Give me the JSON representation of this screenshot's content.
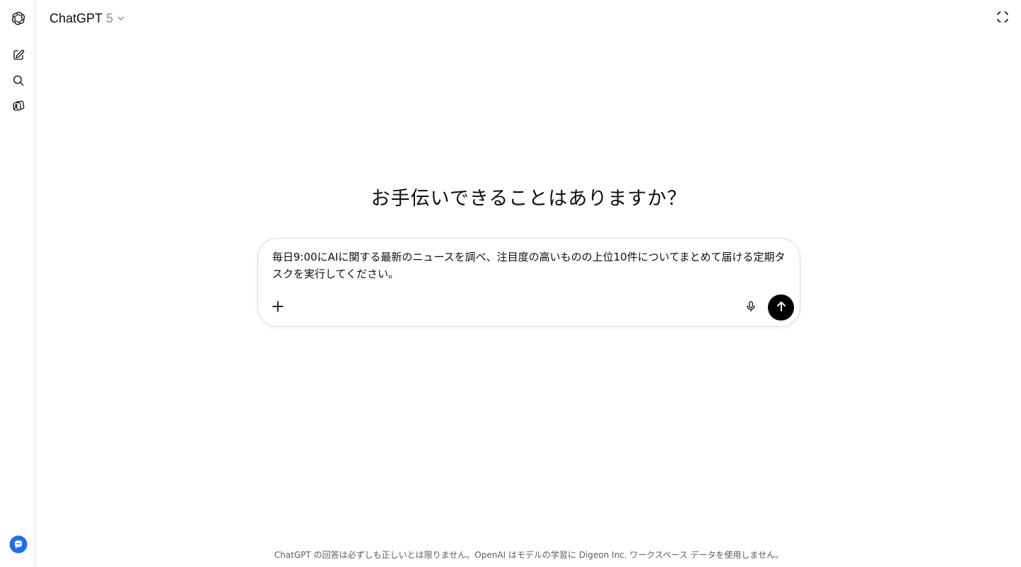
{
  "header": {
    "title": "ChatGPT",
    "version": "5"
  },
  "sidebar": {
    "items": [
      {
        "name": "openai-logo-icon"
      },
      {
        "name": "new-chat-icon"
      },
      {
        "name": "search-icon"
      },
      {
        "name": "library-icon"
      }
    ],
    "help_icon": "chat-help-icon"
  },
  "main": {
    "heading": "お手伝いできることはありますか？",
    "composer": {
      "text": "毎日9:00にAIに関する最新のニュースを調べ、注目度の高いものの上位10件についてまとめて届ける定期タスクを実行してください。"
    },
    "footer": "ChatGPT の回答は必ずしも正しいとは限りません。OpenAI はモデルの学習に Digeon Inc. ワークスペース データを使用しません。"
  },
  "colors": {
    "accent_blue": "#1f6feb",
    "send_button": "#000000",
    "border": "#dcdcdc",
    "footer_text": "#5d5d5d",
    "version_text": "#8f8f8f"
  }
}
